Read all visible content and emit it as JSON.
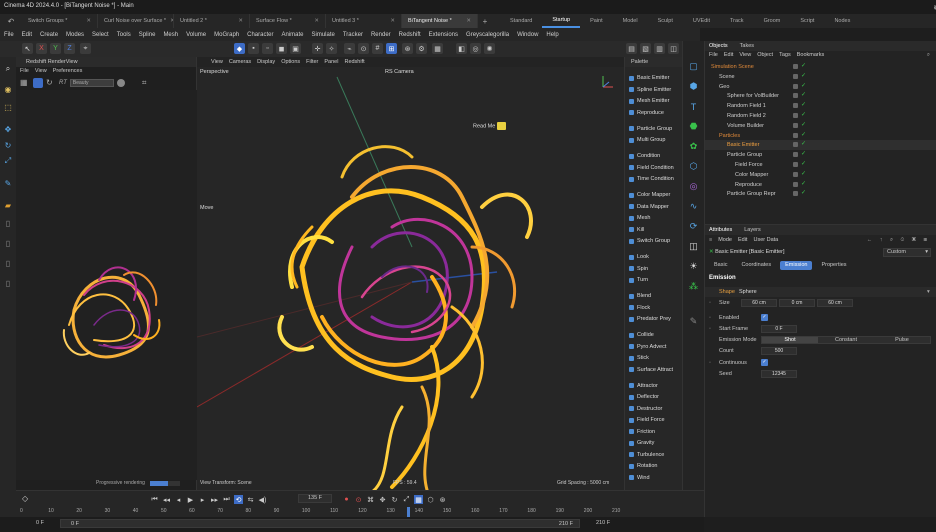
{
  "window": {
    "title": "Cinema 4D 2024.4.0 - [BiTangent Noise *] - Main"
  },
  "doc_tabs": [
    {
      "label": "Switch Groups *"
    },
    {
      "label": "Curl Noise over Surface *"
    },
    {
      "label": "Untitled 2 *"
    },
    {
      "label": "Surface Flow *"
    },
    {
      "label": "Untitled 3 *"
    },
    {
      "label": "BiTangent Noise *"
    }
  ],
  "layouts": [
    "Standard",
    "Startup",
    "Paint",
    "Model",
    "Sculpt",
    "UVEdit",
    "Track",
    "Groom",
    "Script",
    "Nodes"
  ],
  "menu": [
    "File",
    "Edit",
    "Create",
    "Modes",
    "Select",
    "Tools",
    "Spline",
    "Mesh",
    "Volume",
    "MoGraph",
    "Character",
    "Animate",
    "Simulate",
    "Tracker",
    "Render",
    "Redshift",
    "Extensions",
    "Greyscalegorilla",
    "Window",
    "Help"
  ],
  "renderview": {
    "title": "Redshift RenderView",
    "menu": [
      "File",
      "View",
      "Preferences"
    ],
    "aov": "Beauty",
    "progress_label": "Progressive rendering"
  },
  "viewport": {
    "menu": [
      "View",
      "Cameras",
      "Display",
      "Options",
      "Filter",
      "Panel",
      "Redshift"
    ],
    "mode_label": "Perspective",
    "camera_label": "RS Camera",
    "note": "Read Me",
    "move_label": "Move",
    "footer_left": "View Transform: Scene",
    "fps": "FPS : 59.4",
    "grid": "Grid Spacing : 5000 cm"
  },
  "palette": {
    "title": "Palette",
    "groups": [
      [
        "Basic Emitter",
        "Spline Emitter",
        "Mesh Emitter",
        "Reproduce"
      ],
      [
        "Particle Group",
        "Multi Group"
      ],
      [
        "Condition",
        "Field Condition",
        "Time Condition"
      ],
      [
        "Color Mapper",
        "Data Mapper",
        "Mesh",
        "Kill",
        "Switch Group"
      ],
      [
        "Look",
        "Spin",
        "Turn"
      ],
      [
        "Blend",
        "Flock",
        "Predator Prey"
      ],
      [
        "Collide",
        "Pyro Advect",
        "Stick",
        "Surface Attract"
      ],
      [
        "Attractor",
        "Deflector",
        "Destructor",
        "Field Force",
        "Friction",
        "Gravity",
        "Turbulence",
        "Rotation",
        "Wind"
      ]
    ]
  },
  "objects": {
    "tabs": [
      "Objects",
      "Takes"
    ],
    "menu": [
      "File",
      "Edit",
      "View",
      "Object",
      "Tags",
      "Bookmarks"
    ],
    "items": [
      {
        "name": "Simulation Scene",
        "indent": 0,
        "color": "#e08a3a"
      },
      {
        "name": "Scene",
        "indent": 1,
        "color": "#cfcfcf"
      },
      {
        "name": "Geo",
        "indent": 1,
        "color": "#cfcfcf"
      },
      {
        "name": "Sphere for VolBuilder",
        "indent": 2,
        "color": "#cfcfcf"
      },
      {
        "name": "Random Field 1",
        "indent": 2,
        "color": "#cfcfcf"
      },
      {
        "name": "Random Field 2",
        "indent": 2,
        "color": "#cfcfcf"
      },
      {
        "name": "Volume Builder",
        "indent": 2,
        "color": "#cfcfcf"
      },
      {
        "name": "Particles",
        "indent": 1,
        "color": "#e08a3a"
      },
      {
        "name": "Basic Emitter",
        "indent": 2,
        "color": "#f0a040"
      },
      {
        "name": "Particle Group",
        "indent": 2,
        "color": "#cfcfcf"
      },
      {
        "name": "Field Force",
        "indent": 3,
        "color": "#cfcfcf"
      },
      {
        "name": "Color Mapper",
        "indent": 3,
        "color": "#cfcfcf"
      },
      {
        "name": "Reproduce",
        "indent": 3,
        "color": "#cfcfcf"
      },
      {
        "name": "Particle Group Repr",
        "indent": 2,
        "color": "#cfcfcf"
      }
    ]
  },
  "attributes": {
    "tabs": [
      "Attributes",
      "Layers"
    ],
    "menu": [
      "Mode",
      "Edit",
      "User Data"
    ],
    "object_label": "Basic Emitter [Basic Emitter]",
    "preset": "Custom",
    "subtabs": [
      "Basic",
      "Coordinates",
      "Emission",
      "Properties"
    ],
    "section": "Emission",
    "shape_label": "Shape",
    "shape_value": "Sphere",
    "size_label": "Size",
    "size_values": [
      "60 cm",
      "0 cm",
      "60 cm"
    ],
    "enabled_label": "Enabled",
    "start_frame_label": "Start Frame",
    "start_frame": "0 F",
    "emission_mode_label": "Emission Mode",
    "modes": [
      "Shot",
      "Constant",
      "Pulse"
    ],
    "count_label": "Count",
    "count": "500",
    "continuous_label": "Continuous",
    "seed_label": "Seed",
    "seed": "12345"
  },
  "timeline": {
    "current": "135 F",
    "ticks": [
      "0",
      "10",
      "20",
      "30",
      "40",
      "50",
      "60",
      "70",
      "80",
      "90",
      "100",
      "110",
      "120",
      "130",
      "140",
      "150",
      "160",
      "170",
      "180",
      "190",
      "200",
      "210"
    ],
    "start": "0 F",
    "start2": "0 F",
    "end": "210 F",
    "end2": "210 F"
  },
  "colors": {
    "accent": "#4b7fd0",
    "particle_orange": "#ffb020",
    "particle_magenta": "#b02a9a",
    "check": "#39c14b"
  }
}
